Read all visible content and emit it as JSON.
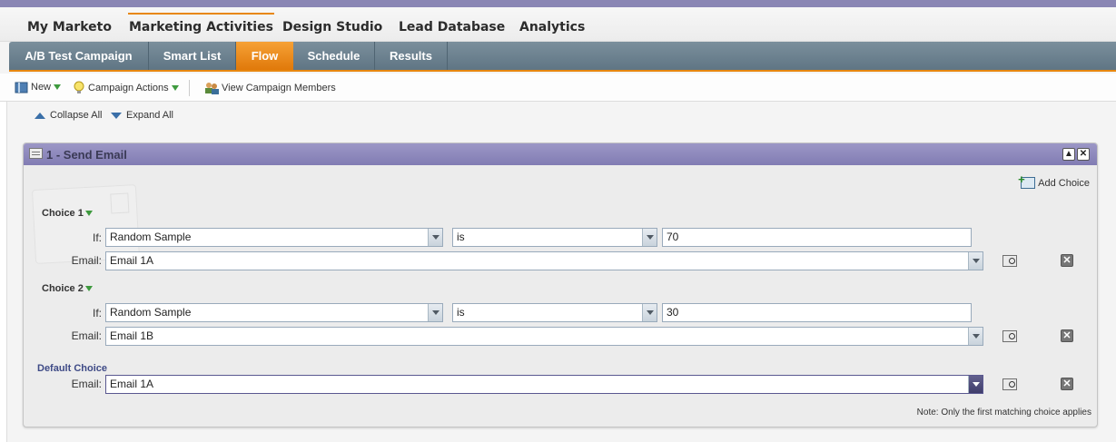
{
  "main_nav": [
    "My Marketo",
    "Marketing Activities",
    "Design Studio",
    "Lead Database",
    "Analytics"
  ],
  "sub_tabs": [
    "A/B Test Campaign",
    "Smart List",
    "Flow",
    "Schedule",
    "Results"
  ],
  "toolbar": {
    "new_label": "New",
    "campaign_actions_label": "Campaign Actions",
    "view_members_label": "View Campaign Members"
  },
  "tree_controls": {
    "collapse_all": "Collapse All",
    "expand_all": "Expand All"
  },
  "step": {
    "title": "1 - Send Email",
    "add_choice_label": "Add Choice",
    "if_label": "If:",
    "email_label": "Email:",
    "choices": [
      {
        "label": "Choice 1",
        "condition": "Random Sample",
        "operator": "is",
        "value": "70",
        "email": "Email 1A"
      },
      {
        "label": "Choice 2",
        "condition": "Random Sample",
        "operator": "is",
        "value": "30",
        "email": "Email 1B"
      }
    ],
    "default_choice": {
      "label": "Default Choice",
      "email": "Email 1A"
    },
    "note": "Note: Only the first matching choice applies"
  },
  "colors": {
    "accent": "#e8870f",
    "header": "#8a86b4",
    "subnav": "#6a7f8d"
  }
}
